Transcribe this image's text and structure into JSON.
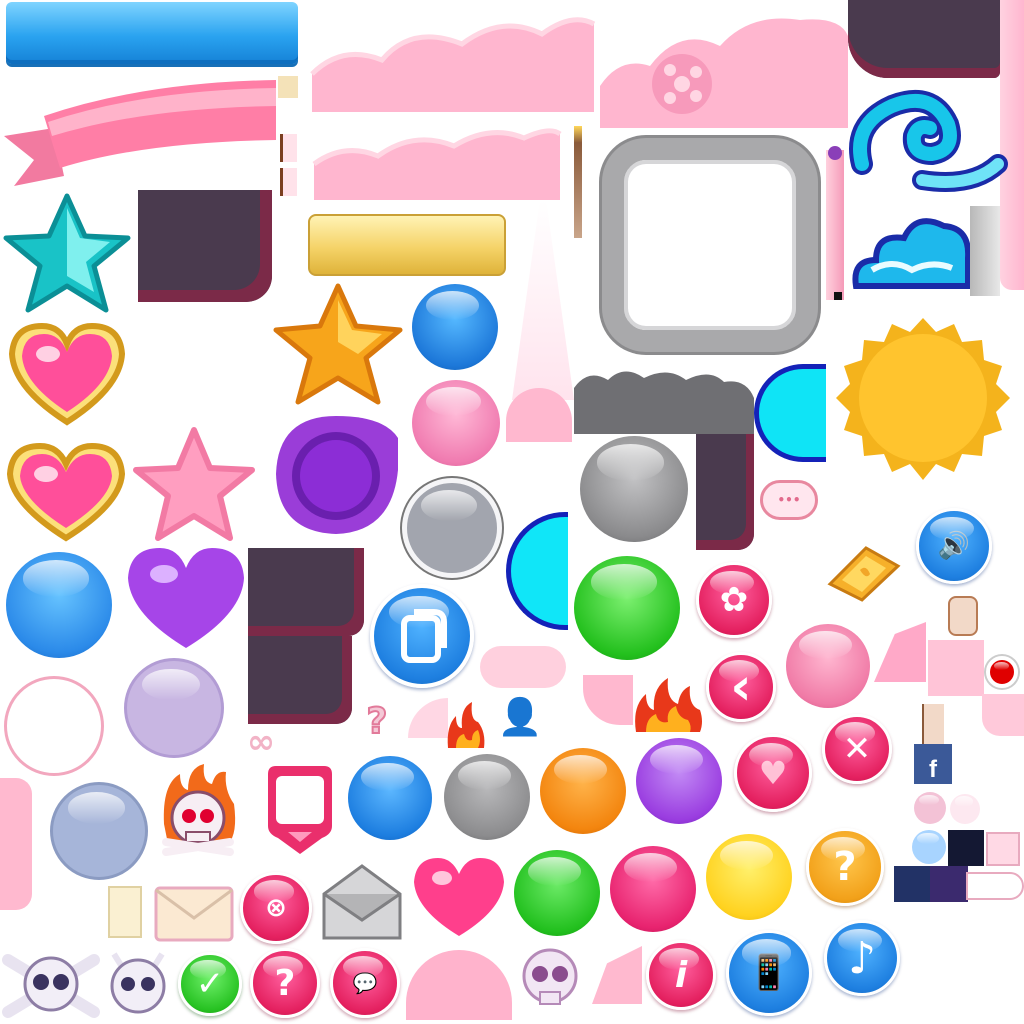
{
  "atlas": {
    "title": "",
    "sprite_count": 100
  },
  "glyphs": {
    "info": "i",
    "question": "?",
    "question_small": "?",
    "cross": "✕",
    "back": "‹",
    "check": "✓",
    "note": "♪",
    "speaker": "🔊",
    "infinity": "∞",
    "chat_dots": "•••",
    "facebook": "f"
  },
  "colors": {
    "pink": "#ff5f9e",
    "blue": "#1e7fe0",
    "green": "#2ec52a",
    "orange": "#f58a12",
    "purple": "#9b3fe0",
    "yellow": "#ffd21f",
    "gray": "#8e8e8e",
    "gold": "#f2b21c",
    "cyan": "#12d9e8",
    "dark": "#4a3a4e",
    "pink_band": "#ffb9d1"
  },
  "icons": [
    "ribbon-banner-icon",
    "star-icon",
    "heart-icon",
    "skull-icon",
    "envelope-icon",
    "facebook-icon",
    "music-note-icon",
    "speaker-icon",
    "info-icon",
    "question-icon",
    "check-icon",
    "close-icon",
    "back-arrow-icon",
    "flower-icon",
    "chat-icon",
    "gold-bar-icon",
    "flame-icon",
    "frame-icon"
  ]
}
